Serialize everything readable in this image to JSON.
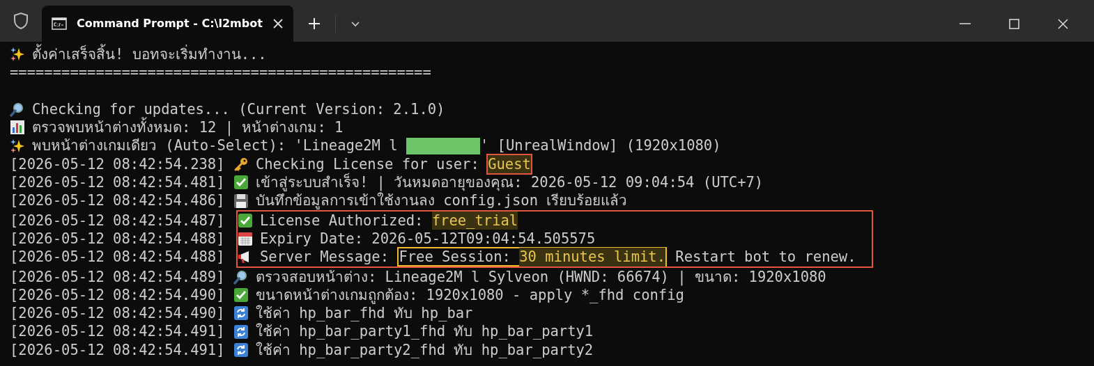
{
  "window": {
    "tab_title": "Command Prompt - C:\\l2mbot",
    "tab_selected": true
  },
  "log": [
    {
      "kind": "sparkles",
      "segments": [
        {
          "kind": "text",
          "text": "ตั้งค่าเสร็จสิ้น! บอทจะเริ่มทำงาน...",
          "highlighted": false
        }
      ]
    },
    {
      "kind": "plain",
      "segments": [
        {
          "kind": "text",
          "text": "=================================================",
          "highlighted": false
        }
      ]
    },
    {
      "kind": "blank"
    },
    {
      "kind": "search",
      "segments": [
        {
          "kind": "text",
          "text": "Checking for updates... (Current Version: 2.1.0)",
          "highlighted": false
        }
      ]
    },
    {
      "kind": "chart",
      "segments": [
        {
          "kind": "text",
          "text": "ตรวจพบหน้าต่างทั้งหมด: 12 | หน้าต่างเกม: 1",
          "highlighted": false
        }
      ]
    },
    {
      "kind": "sparkles",
      "segments": [
        {
          "kind": "text",
          "text": "พบหน้าต่างเกมเดียว (Auto-Select): 'Lineage2M l ",
          "highlighted": false
        },
        {
          "kind": "redacted"
        },
        {
          "kind": "text",
          "text": "' [UnrealWindow] (1920x1080)",
          "highlighted": false
        }
      ]
    },
    {
      "kind": "key",
      "timestamp": "[2026-05-12 08:42:54.238]",
      "segments": [
        {
          "kind": "text",
          "text": "Checking License for user: ",
          "highlighted": false
        },
        {
          "kind": "text",
          "text": "Guest",
          "highlighted": true,
          "outlined": true
        }
      ]
    },
    {
      "kind": "check",
      "timestamp": "[2026-05-12 08:42:54.481]",
      "segments": [
        {
          "kind": "text",
          "text": "เข้าสู่ระบบสำเร็จ! | วันหมดอายุของคุณ: 2026-05-12 09:04:54 (UTC+7)",
          "highlighted": false
        }
      ]
    },
    {
      "kind": "floppy",
      "timestamp": "[2026-05-12 08:42:54.486]",
      "segments": [
        {
          "kind": "text",
          "text": "บันทึกข้อมูลการเข้าใช้งานลง config.json เรียบร้อยแล้ว",
          "highlighted": false
        }
      ]
    },
    {
      "kind": "check",
      "framed": true,
      "timestamp": "[2026-05-12 08:42:54.487]",
      "segments": [
        {
          "kind": "text",
          "text": "License Authorized: ",
          "highlighted": false
        },
        {
          "kind": "text",
          "text": "free_trial",
          "highlighted": true
        }
      ]
    },
    {
      "kind": "calendar",
      "framed": true,
      "timestamp": "[2026-05-12 08:42:54.488]",
      "segments": [
        {
          "kind": "text",
          "text": "Expiry Date: 2026-05-12T09:04:54.505575",
          "highlighted": false
        }
      ]
    },
    {
      "kind": "megaphone",
      "framed": true,
      "timestamp": "[2026-05-12 08:42:54.488]",
      "segments": [
        {
          "kind": "text",
          "text": "Server Message: ",
          "highlighted": false
        },
        {
          "kind": "callout",
          "parts": [
            {
              "text": "Free Session: ",
              "highlighted": false
            },
            {
              "text": "30 minutes limit.",
              "highlighted": true
            }
          ]
        },
        {
          "kind": "text",
          "text": " Restart bot to renew.",
          "highlighted": false
        }
      ]
    },
    {
      "kind": "search",
      "timestamp": "[2026-05-12 08:42:54.489]",
      "segments": [
        {
          "kind": "text",
          "text": "ตรวจสอบหน้าต่าง: Lineage2M l Sylveon (HWND: 66674) | ขนาด: 1920x1080",
          "highlighted": false
        }
      ]
    },
    {
      "kind": "check",
      "timestamp": "[2026-05-12 08:42:54.490]",
      "segments": [
        {
          "kind": "text",
          "text": "ขนาดหน้าต่างเกมถูกต้อง: 1920x1080 - apply *_fhd config",
          "highlighted": false
        }
      ]
    },
    {
      "kind": "refresh",
      "timestamp": "[2026-05-12 08:42:54.490]",
      "segments": [
        {
          "kind": "text",
          "text": "ใช้ค่า hp_bar_fhd ทับ hp_bar",
          "highlighted": false
        }
      ]
    },
    {
      "kind": "refresh",
      "timestamp": "[2026-05-12 08:42:54.491]",
      "segments": [
        {
          "kind": "text",
          "text": "ใช้ค่า hp_bar_party1_fhd ทับ hp_bar_party1",
          "highlighted": false
        }
      ]
    },
    {
      "kind": "refresh",
      "timestamp": "[2026-05-12 08:42:54.491]",
      "segments": [
        {
          "kind": "text",
          "text": "ใช้ค่า hp_bar_party2_fhd ทับ hp_bar_party2",
          "highlighted": false
        }
      ]
    }
  ]
}
